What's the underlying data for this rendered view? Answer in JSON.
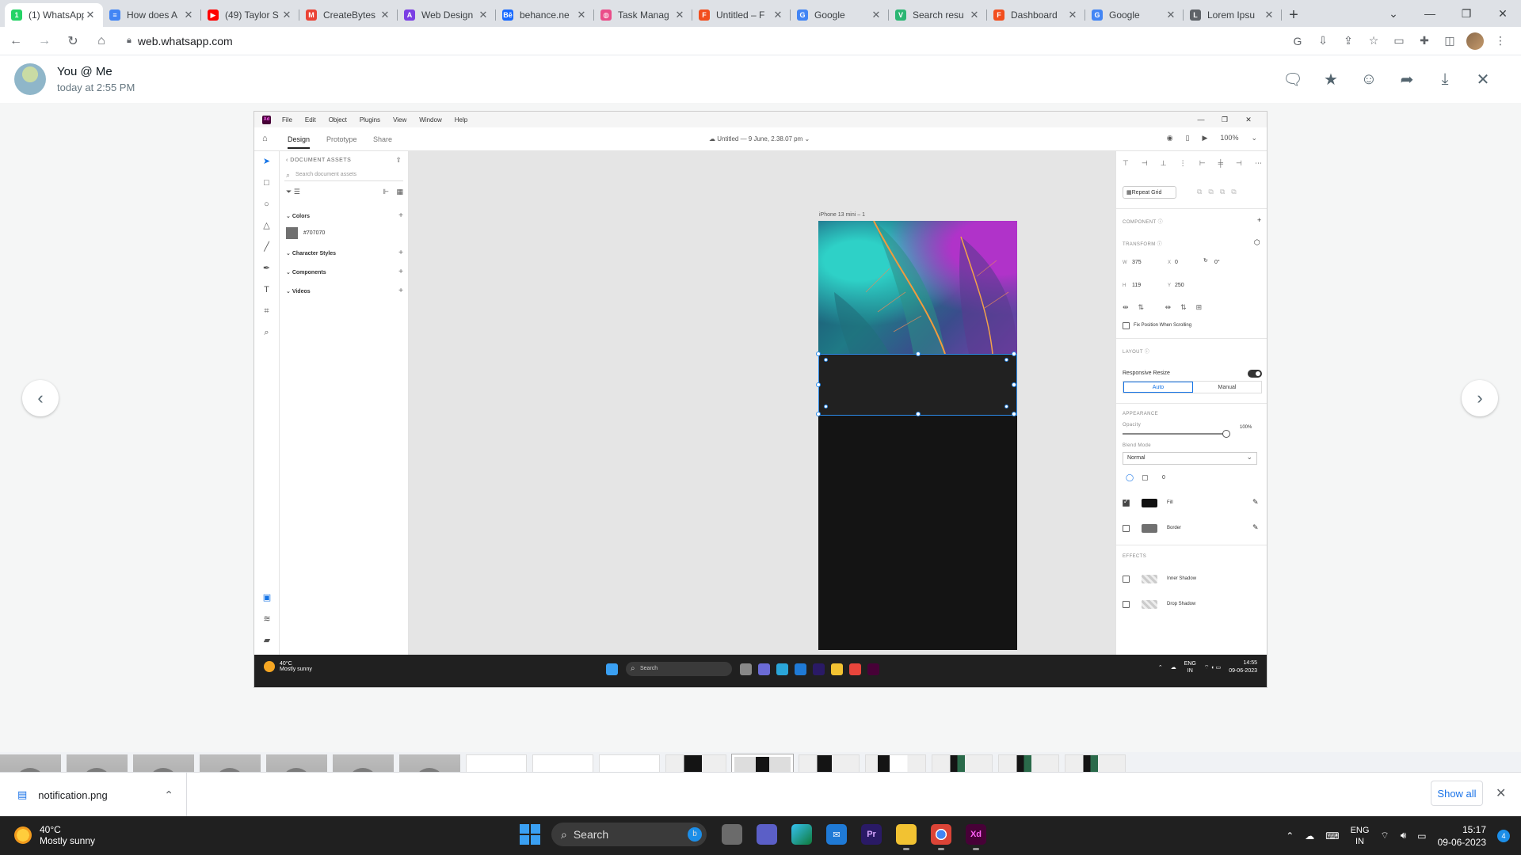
{
  "browser": {
    "tabs": [
      {
        "title": "(1) WhatsApp",
        "favicon_color": "#25d366",
        "favicon_glyph": "1"
      },
      {
        "title": "How does A",
        "favicon_color": "#4285f4",
        "favicon_glyph": "≡"
      },
      {
        "title": "(49) Taylor S",
        "favicon_color": "#ff0000",
        "favicon_glyph": "▶"
      },
      {
        "title": "CreateBytes",
        "favicon_color": "#ea4335",
        "favicon_glyph": "M"
      },
      {
        "title": "Web Design",
        "favicon_color": "#7b3fe4",
        "favicon_glyph": "A"
      },
      {
        "title": "behance.ne",
        "favicon_color": "#1769ff",
        "favicon_glyph": "Bē"
      },
      {
        "title": "Task Manag",
        "favicon_color": "#ea4c89",
        "favicon_glyph": "◍"
      },
      {
        "title": "Untitled – F",
        "favicon_color": "#f24e1e",
        "favicon_glyph": "F"
      },
      {
        "title": "Google",
        "favicon_color": "#4285f4",
        "favicon_glyph": "G"
      },
      {
        "title": "Search resu",
        "favicon_color": "#2bb673",
        "favicon_glyph": "V"
      },
      {
        "title": "Dashboard",
        "favicon_color": "#f24e1e",
        "favicon_glyph": "F"
      },
      {
        "title": "Google",
        "favicon_color": "#4285f4",
        "favicon_glyph": "G"
      },
      {
        "title": "Lorem Ipsu",
        "favicon_color": "#5f6368",
        "favicon_glyph": "L"
      }
    ],
    "new_tab": "+",
    "url": "web.whatsapp.com"
  },
  "viewer": {
    "sender": "You @ Me",
    "timestamp": "today at 2:55 PM",
    "actions": [
      "chat-icon",
      "star-icon",
      "emoji-icon",
      "forward-icon",
      "download-icon",
      "close-icon"
    ]
  },
  "xd": {
    "menu": [
      "File",
      "Edit",
      "Object",
      "Plugins",
      "View",
      "Window",
      "Help"
    ],
    "tabs": [
      "Design",
      "Prototype",
      "Share"
    ],
    "document": "Untitled — 9 June, 2.38.07 pm",
    "zoom": "100%",
    "assets": {
      "header": "DOCUMENT ASSETS",
      "search_placeholder": "Search document assets",
      "sections": {
        "colors": "Colors",
        "character_styles": "Character Styles",
        "components": "Components",
        "videos": "Videos"
      },
      "color_value": "#707070"
    },
    "artboard_label": "iPhone 13 mini – 1",
    "properties": {
      "repeat_grid": "Repeat Grid",
      "component": "COMPONENT",
      "transform": "TRANSFORM",
      "w_label": "W",
      "w": "375",
      "x_label": "X",
      "x": "0",
      "rotation": "0°",
      "h_label": "H",
      "h": "119",
      "y_label": "Y",
      "y": "250",
      "fix_position": "Fix Position When Scrolling",
      "layout": "LAYOUT",
      "responsive_resize": "Responsive Resize",
      "auto": "Auto",
      "manual": "Manual",
      "appearance": "APPEARANCE",
      "opacity_label": "Opacity",
      "opacity": "100%",
      "blend_mode_label": "Blend Mode",
      "blend_mode": "Normal",
      "corner": "0",
      "fill": "Fill",
      "border": "Border",
      "effects": "EFFECTS",
      "inner_shadow": "Inner Shadow",
      "drop_shadow": "Drop Shadow"
    },
    "taskbar": {
      "temp": "40°C",
      "weather": "Mostly sunny",
      "search": "Search",
      "lang": "ENG",
      "region": "IN",
      "time": "14:55",
      "date": "09-06-2023"
    }
  },
  "downloads": {
    "file": "notification.png",
    "show_all": "Show all"
  },
  "taskbar": {
    "temp": "40°C",
    "weather": "Mostly sunny",
    "search": "Search",
    "lang": "ENG",
    "region": "IN",
    "time": "15:17",
    "date": "09-06-2023",
    "notifications": "4"
  },
  "colors": {
    "artboard": "#141414",
    "selected_block": "#212121",
    "selection": "#2d8ceb",
    "xd_accent": "#1473e6"
  }
}
